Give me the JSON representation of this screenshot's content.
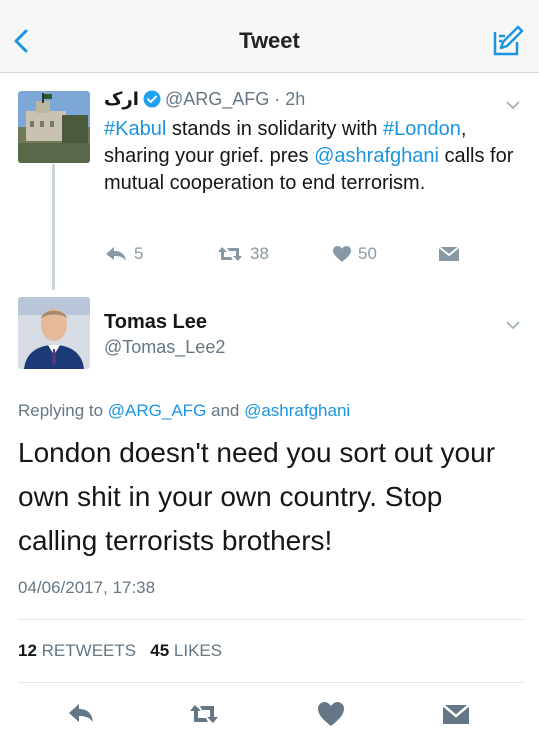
{
  "nav": {
    "title": "Tweet"
  },
  "quoted": {
    "name": "ارک",
    "handle": "@ARG_AFG",
    "time": "· 2h",
    "text": {
      "hashtag1": "#Kabul",
      "part1": " stands in solidarity with ",
      "hashtag2": "#London",
      "part2": ", sharing your grief. pres ",
      "mention": "@ashrafghani",
      "part3": " calls for mutual cooperation to end terrorism."
    },
    "replies": "5",
    "retweets": "38",
    "likes": "50"
  },
  "reply": {
    "name": "Tomas Lee",
    "handle": "@Tomas_Lee2",
    "replying_prefix": "Replying to ",
    "replying_user1": "@ARG_AFG",
    "replying_and": " and ",
    "replying_user2": "@ashrafghani",
    "text": "London doesn't need you sort out your own shit in your own country. Stop calling terrorists brothers!",
    "timestamp": "04/06/2017, 17:38",
    "retweet_count": "12",
    "retweet_label": " RETWEETS",
    "like_count": "45",
    "like_label": " LIKES"
  },
  "colors": {
    "link": "#1b95e0",
    "muted": "#657786",
    "action_icon": "#8899a6",
    "verified": "#1da1f2"
  }
}
